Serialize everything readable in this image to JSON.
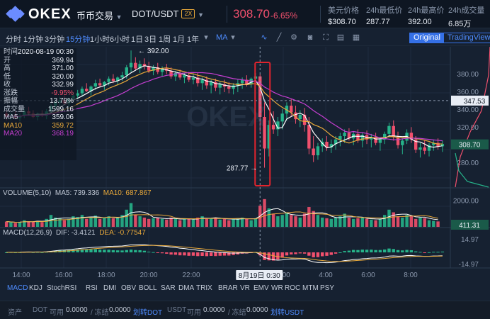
{
  "header": {
    "logo_text": "OKEX",
    "market_menu": "币币交易",
    "pair": "DOT/USDT",
    "leverage": "2X",
    "last_price": "308.70",
    "change_pct": "-6.65%",
    "stats": [
      {
        "label": "美元价格",
        "value": "$308.70"
      },
      {
        "label": "24h最低价",
        "value": "287.77"
      },
      {
        "label": "24h最高价",
        "value": "392.00"
      },
      {
        "label": "24h成交量",
        "value": "6.85万"
      }
    ]
  },
  "toolbar": {
    "intervals": [
      "分时",
      "1分钟",
      "3分钟",
      "15分钟",
      "1小时",
      "6小时",
      "1日",
      "3日",
      "1周",
      "1月",
      "1年"
    ],
    "active_interval": "15分钟",
    "ma_select": "MA",
    "view_original": "Original",
    "view_tradingview": "TradingView"
  },
  "info_panel": {
    "rows": [
      {
        "label": "时间",
        "value": "2020-08-19 00:30"
      },
      {
        "label": "开",
        "value": "369.94"
      },
      {
        "label": "高",
        "value": "371.00"
      },
      {
        "label": "低",
        "value": "320.00"
      },
      {
        "label": "收",
        "value": "332.99"
      },
      {
        "label": "涨跌",
        "value": "-9.95%"
      },
      {
        "label": "振幅",
        "value": "13.79%"
      },
      {
        "label": "成交量",
        "value": "1599.16"
      },
      {
        "label": "MA5",
        "value": "359.06"
      },
      {
        "label": "MA10",
        "value": "359.72"
      },
      {
        "label": "MA20",
        "value": "368.19"
      }
    ]
  },
  "price_axis": {
    "ticks": [
      "380.00",
      "360.00",
      "340.00",
      "320.00",
      "300.00",
      "280.00"
    ],
    "crosshair_label": "347.53",
    "last_label": "308.70",
    "high_marker": "392.00",
    "low_marker": "287.77"
  },
  "volume": {
    "title": "VOLUME(5,10)",
    "ma5": "MA5: 739.336",
    "ma10": "MA10: 687.867",
    "axis_tick": "2000.00",
    "last_label": "411.31"
  },
  "macd": {
    "title": "MACD(12,26,9)",
    "dif": "DIF: -3.4121",
    "dea": "DEA: -0.77547",
    "axis_top": "14.97",
    "axis_bottom": "-14.97"
  },
  "time_axis": {
    "ticks": [
      "14:00",
      "16:00",
      "18:00",
      "20:00",
      "22:00",
      "2:00",
      "4:00",
      "6:00",
      "8:00"
    ],
    "crosshair_label": "8月19日 0:30"
  },
  "indicator_tabs": [
    "MACD",
    "KDJ",
    "StochRSI",
    "RSI",
    "DMI",
    "OBV",
    "BOLL",
    "SAR",
    "DMA",
    "TRIX",
    "BRAR",
    "VR",
    "EMV",
    "WR",
    "ROC",
    "MTM",
    "PSY"
  ],
  "active_indicator": "MACD",
  "footer": {
    "assets_label": "资产",
    "dot_label": "DOT",
    "available": "可用",
    "dot_available": "0.0000",
    "frozen": "/ 冻结",
    "dot_frozen": "0.0000",
    "dot_transfer": "划转DOT",
    "usdt_label": "USDT",
    "usdt_available": "0.0000",
    "usdt_frozen": "0.0000",
    "usdt_transfer": "划转USDT"
  },
  "colors": {
    "up": "#26b38a",
    "down": "#f0506d",
    "ma5": "#ffffff",
    "ma10": "#e9a93a",
    "ma20": "#c53ed1",
    "accent": "#3570e6"
  },
  "chart_data": {
    "type": "candlestick",
    "interval": "15m",
    "ylim": [
      272,
      394
    ],
    "candles_ohlc": [
      [
        336,
        339,
        330,
        333
      ],
      [
        333,
        337,
        330,
        335
      ],
      [
        335,
        338,
        331,
        332
      ],
      [
        332,
        336,
        329,
        334
      ],
      [
        334,
        340,
        332,
        338
      ],
      [
        338,
        342,
        334,
        336
      ],
      [
        336,
        339,
        332,
        333
      ],
      [
        333,
        337,
        330,
        336
      ],
      [
        336,
        339,
        333,
        334
      ],
      [
        334,
        340,
        331,
        338
      ],
      [
        338,
        345,
        336,
        343
      ],
      [
        343,
        349,
        340,
        346
      ],
      [
        346,
        351,
        342,
        348
      ],
      [
        348,
        352,
        344,
        345
      ],
      [
        345,
        350,
        342,
        349
      ],
      [
        349,
        355,
        347,
        352
      ],
      [
        352,
        357,
        349,
        354
      ],
      [
        354,
        360,
        351,
        358
      ],
      [
        358,
        363,
        355,
        356
      ],
      [
        356,
        361,
        352,
        360
      ],
      [
        360,
        366,
        357,
        363
      ],
      [
        363,
        367,
        359,
        361
      ],
      [
        361,
        365,
        357,
        364
      ],
      [
        364,
        369,
        361,
        367
      ],
      [
        367,
        371,
        363,
        365
      ],
      [
        365,
        369,
        361,
        368
      ],
      [
        368,
        373,
        365,
        370
      ],
      [
        370,
        379,
        367,
        377
      ],
      [
        377,
        392,
        373,
        381
      ],
      [
        381,
        386,
        374,
        376
      ],
      [
        376,
        383,
        372,
        380
      ],
      [
        380,
        385,
        375,
        378
      ],
      [
        378,
        382,
        372,
        374
      ],
      [
        374,
        379,
        370,
        377
      ],
      [
        377,
        381,
        371,
        373
      ],
      [
        373,
        378,
        369,
        376
      ],
      [
        376,
        380,
        371,
        374
      ],
      [
        374,
        377,
        367,
        369
      ],
      [
        369,
        374,
        365,
        372
      ],
      [
        372,
        375,
        366,
        368
      ],
      [
        368,
        372,
        363,
        370
      ],
      [
        370,
        373,
        364,
        366
      ],
      [
        366,
        371,
        362,
        368
      ],
      [
        368,
        372,
        360,
        363
      ],
      [
        363,
        368,
        357,
        366
      ],
      [
        366,
        369,
        358,
        361
      ],
      [
        361,
        366,
        354,
        364
      ],
      [
        364,
        367,
        356,
        359
      ],
      [
        359,
        364,
        353,
        362
      ],
      [
        362,
        366,
        355,
        360
      ],
      [
        360,
        364,
        354,
        358
      ],
      [
        358,
        363,
        353,
        361
      ],
      [
        361,
        366,
        355,
        363
      ],
      [
        363,
        368,
        358,
        366
      ],
      [
        366,
        370,
        360,
        362
      ],
      [
        362,
        368,
        359,
        367
      ],
      [
        367,
        372,
        361,
        369
      ],
      [
        369,
        371,
        320,
        333
      ],
      [
        333,
        346,
        288,
        305
      ],
      [
        305,
        330,
        298,
        326
      ],
      [
        326,
        338,
        318,
        322
      ],
      [
        322,
        333,
        316,
        329
      ],
      [
        329,
        340,
        322,
        336
      ],
      [
        336,
        346,
        330,
        343
      ],
      [
        343,
        349,
        333,
        337
      ],
      [
        337,
        343,
        327,
        331
      ],
      [
        331,
        339,
        324,
        335
      ],
      [
        335,
        341,
        320,
        326
      ],
      [
        326,
        333,
        300,
        305
      ],
      [
        305,
        316,
        293,
        299
      ],
      [
        299,
        310,
        295,
        307
      ],
      [
        307,
        314,
        302,
        311
      ],
      [
        311,
        316,
        303,
        306
      ],
      [
        306,
        313,
        301,
        309
      ],
      [
        309,
        316,
        304,
        313
      ],
      [
        313,
        319,
        307,
        316
      ],
      [
        316,
        322,
        310,
        319
      ],
      [
        319,
        323,
        312,
        314
      ],
      [
        314,
        320,
        308,
        318
      ],
      [
        318,
        322,
        310,
        312
      ],
      [
        312,
        319,
        306,
        317
      ],
      [
        317,
        321,
        309,
        313
      ],
      [
        313,
        318,
        306,
        315
      ],
      [
        315,
        319,
        308,
        310
      ],
      [
        310,
        315,
        303,
        313
      ],
      [
        313,
        320,
        309,
        318
      ],
      [
        318,
        328,
        315,
        325
      ],
      [
        325,
        330,
        312,
        315
      ],
      [
        315,
        320,
        305,
        308
      ],
      [
        308,
        314,
        300,
        312
      ],
      [
        312,
        322,
        309,
        319
      ],
      [
        319,
        324,
        310,
        313
      ],
      [
        313,
        316,
        301,
        304
      ],
      [
        304,
        310,
        297,
        306
      ],
      [
        306,
        312,
        300,
        303
      ],
      [
        303,
        310,
        298,
        308
      ],
      [
        308,
        313,
        303,
        310
      ],
      [
        310,
        314,
        304,
        307
      ],
      [
        307,
        312,
        302,
        309
      ]
    ],
    "volume": [
      400,
      350,
      300,
      380,
      500,
      420,
      380,
      450,
      360,
      600,
      900,
      700,
      650,
      500,
      600,
      800,
      750,
      900,
      600,
      700,
      850,
      600,
      700,
      800,
      650,
      700,
      900,
      1300,
      1800,
      900,
      800,
      700,
      600,
      650,
      700,
      600,
      550,
      700,
      600,
      500,
      650,
      600,
      550,
      700,
      800,
      600,
      650,
      700,
      550,
      600,
      500,
      600,
      650,
      700,
      600,
      500,
      650,
      1599,
      2100,
      1400,
      1000,
      800,
      900,
      1100,
      900,
      800,
      700,
      1000,
      1500,
      1200,
      900,
      700,
      650,
      600,
      700,
      800,
      1000,
      700,
      600,
      650,
      700,
      600,
      550,
      500,
      600,
      900,
      1300,
      1100,
      800,
      700,
      900,
      800,
      600,
      700,
      650,
      500,
      450,
      411
    ],
    "time_ticks": [
      "14:00",
      "16:00",
      "18:00",
      "20:00",
      "22:00",
      "0:30",
      "2:00",
      "4:00",
      "6:00",
      "8:00"
    ]
  }
}
